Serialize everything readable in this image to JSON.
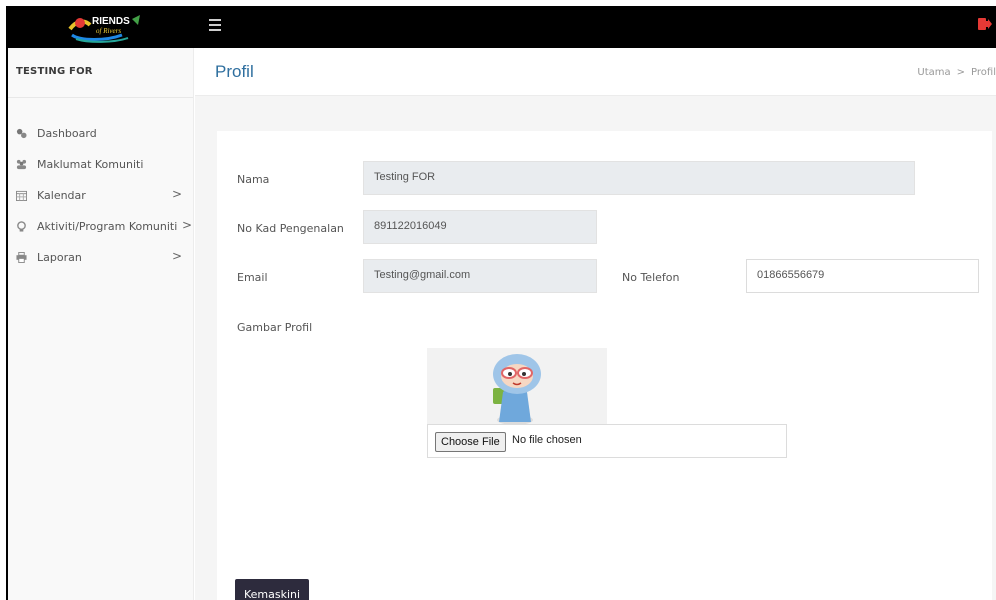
{
  "app": {
    "logo_text": "FRIENDS of Rivers",
    "user_name": "TESTING FOR"
  },
  "colors": {
    "topbar": "#000000",
    "accent": "#2f6f9f",
    "logout": "#e53935",
    "button": "#2d2b3d"
  },
  "sidebar": {
    "items": [
      {
        "label": "Dashboard",
        "icon": "dashboard-icon",
        "has_chevron": false
      },
      {
        "label": "Maklumat Komuniti",
        "icon": "users-icon",
        "has_chevron": false
      },
      {
        "label": "Kalendar",
        "icon": "calendar-icon",
        "has_chevron": true,
        "chevron": ">"
      },
      {
        "label": "Aktiviti/Program Komuniti",
        "icon": "lightbulb-icon",
        "has_chevron": true,
        "chevron": ">"
      },
      {
        "label": "Laporan",
        "icon": "print-icon",
        "has_chevron": true,
        "chevron": ">"
      }
    ]
  },
  "header": {
    "title": "Profil",
    "breadcrumb": [
      "Utama",
      "Profil"
    ],
    "breadcrumb_sep": ">"
  },
  "form": {
    "nama": {
      "label": "Nama",
      "value": "Testing FOR"
    },
    "ic": {
      "label": "No Kad Pengenalan",
      "value": "891122016049"
    },
    "email": {
      "label": "Email",
      "value": "Testing@gmail.com"
    },
    "phone": {
      "label": "No Telefon",
      "value": "01866556679"
    },
    "picture": {
      "label": "Gambar Profil",
      "choose_label": "Choose File",
      "status": "No file chosen"
    },
    "submit_label": "Kemaskini"
  }
}
